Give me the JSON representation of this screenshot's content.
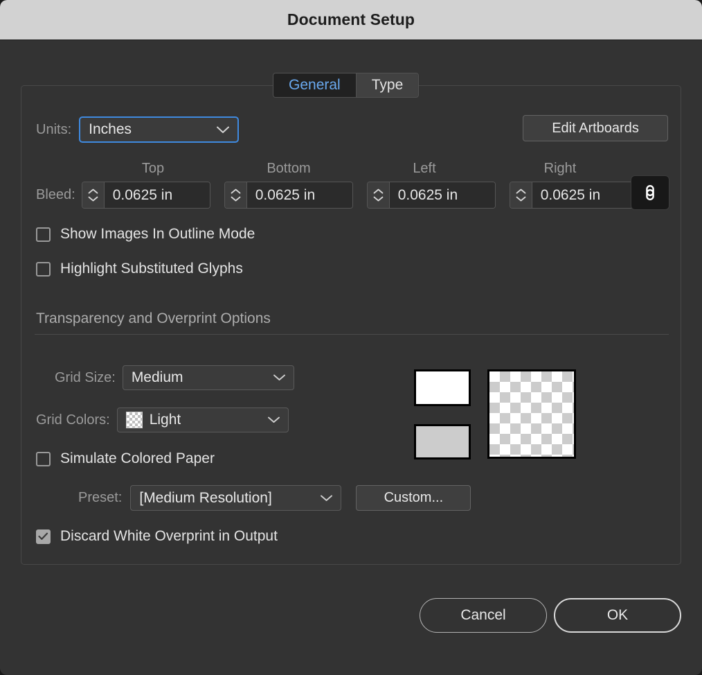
{
  "window": {
    "title": "Document Setup"
  },
  "tabs": [
    {
      "label": "General",
      "active": true
    },
    {
      "label": "Type",
      "active": false
    }
  ],
  "general": {
    "units": {
      "label": "Units:",
      "value": "Inches"
    },
    "edit_artboards_label": "Edit Artboards",
    "bleed": {
      "label": "Bleed:",
      "headers": [
        "Top",
        "Bottom",
        "Left",
        "Right"
      ],
      "values": [
        "0.0625 in",
        "0.0625 in",
        "0.0625 in",
        "0.0625 in"
      ],
      "link_icon": "link-chain-icon"
    },
    "checkboxes": [
      {
        "label": "Show Images In Outline Mode",
        "checked": false
      },
      {
        "label": "Highlight Substituted Glyphs",
        "checked": false
      }
    ]
  },
  "transparency": {
    "section_title": "Transparency and Overprint Options",
    "grid_size": {
      "label": "Grid Size:",
      "value": "Medium"
    },
    "grid_colors": {
      "label": "Grid Colors:",
      "value": "Light",
      "swatch_icon": "checkerboard-swatch-icon"
    },
    "simulate_colored_paper": {
      "label": "Simulate Colored Paper",
      "checked": false
    },
    "preset": {
      "label": "Preset:",
      "value": "[Medium Resolution]",
      "custom_label": "Custom..."
    },
    "discard_white_overprint": {
      "label": "Discard White Overprint in Output",
      "checked": true
    },
    "preview": {
      "swatch_one_color": "#FFFFFF",
      "swatch_two_color": "#CCCCCC",
      "checker_light": "#FFFFFF",
      "checker_dark": "#CCCCCC"
    }
  },
  "footer": {
    "cancel_label": "Cancel",
    "ok_label": "OK"
  },
  "colors": {
    "dialog_background": "#333333",
    "titlebar_background": "#D2D2D2",
    "accent_blue": "#6AA9EF",
    "focus_blue": "#3F8AE0"
  }
}
